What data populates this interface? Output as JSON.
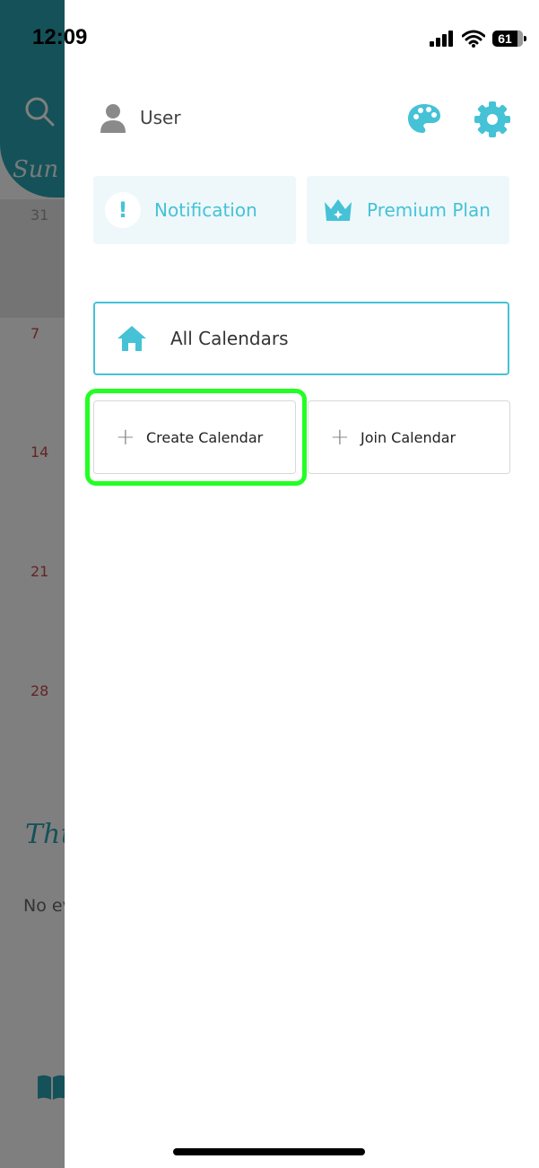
{
  "status_bar": {
    "time": "12:09",
    "battery": "61"
  },
  "background": {
    "weekday": "Sun",
    "dates": [
      "31",
      "7",
      "14",
      "21",
      "28"
    ],
    "panel_day": "Thu",
    "panel_text": "No ev"
  },
  "drawer": {
    "user_label": "User",
    "notification_label": "Notification",
    "notification_glyph": "!",
    "premium_label": "Premium Plan",
    "all_calendars_label": "All Calendars",
    "create_calendar_label": "Create Calendar",
    "join_calendar_label": "Join Calendar",
    "plus_glyph": "+"
  },
  "colors": {
    "accent": "#45c2d6",
    "teal_header": "#2aa3b1",
    "highlight": "#22ff22"
  },
  "icons": [
    "search-icon",
    "user-icon",
    "palette-icon",
    "gear-icon",
    "crown-icon",
    "home-icon",
    "book-icon"
  ]
}
